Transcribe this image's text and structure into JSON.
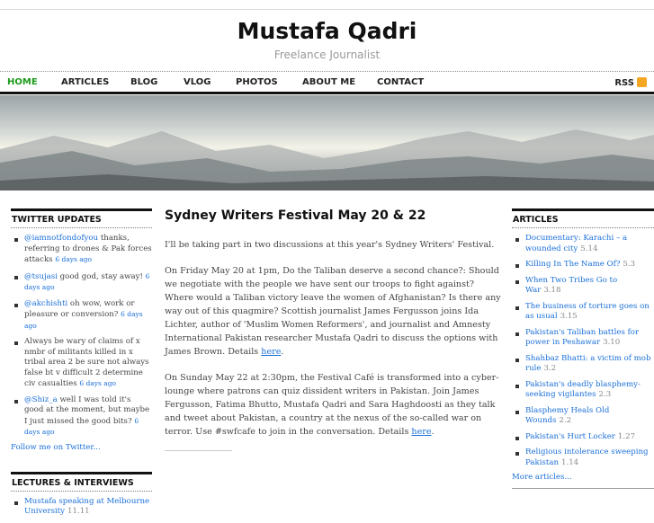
{
  "site": {
    "title": "Mustafa Qadri",
    "tagline": "Freelance Journalist"
  },
  "nav": {
    "items": [
      "HOME",
      "ARTICLES",
      "BLOG",
      "VLOG",
      "PHOTOS",
      "ABOUT ME",
      "CONTACT"
    ],
    "rss": "RSS"
  },
  "twitter": {
    "heading": "TWITTER UPDATES",
    "tweets": [
      {
        "user": "@iamnotfondofyou",
        "text": " thanks, referring to drones & Pak forces attacks ",
        "ago": "6 days ago"
      },
      {
        "user": "@tsujasi",
        "text": " good god, stay away! ",
        "ago": "6 days ago"
      },
      {
        "user": "@akchishti",
        "text": " oh wow, work or pleasure or conversion? ",
        "ago": "6 days ago"
      },
      {
        "user": "",
        "text": "Always be wary of claims of x nmbr of militants killed in x tribal area 2 be sure not always false bt v difficult 2 determine civ casualties ",
        "ago": "6 days ago"
      },
      {
        "user": "@Shiz_a",
        "text": " well I was told it's good at the moment, but maybe I just missed the good bits? ",
        "ago": "6 days ago"
      }
    ],
    "follow": "Follow me on Twitter..."
  },
  "lectures": {
    "heading": "LECTURES & INTERVIEWS",
    "items": [
      {
        "title": "Mustafa speaking at Melbourne University",
        "date": "11.11"
      }
    ]
  },
  "post": {
    "title": "Sydney Writers Festival May 20 & 22",
    "p1": "I'll be taking part in two discussions at this year's Sydney Writers' Festival.",
    "p2": "On Friday May 20 at 1pm, Do the Taliban deserve a second chance?: Should we negotiate with the people we have sent our troops to fight against? Where would a Taliban victory leave the women of Afghanistan? Is there any way out of this quagmire? Scottish journalist James Fergusson joins Ida Lichter, author of 'Muslim Women Reformers', and journalist and Amnesty International Pakistan researcher Mustafa Qadri to discuss the options with James Brown. Details ",
    "p3": "On Sunday May 22 at 2:30pm, the Festival Café is transformed into a cyber-lounge where patrons can quiz dissident writers in Pakistan. Join James Fergusson, Fatima Bhutto, Mustafa Qadri and Sara Haghdoosti as they talk and tweet about Pakistan, a country at the nexus of the so-called war on terror. Use #swfcafe to join in the conversation. Details ",
    "link": "here",
    "end": "."
  },
  "articles": {
    "heading": "ARTICLES",
    "items": [
      {
        "title": "Documentary: Karachi – a wounded city",
        "date": "5.14"
      },
      {
        "title": "Killing In The Name Of?",
        "date": "5.3"
      },
      {
        "title": "When Two Tribes Go to War",
        "date": "3.18"
      },
      {
        "title": "The business of torture goes on as usual",
        "date": "3.15"
      },
      {
        "title": "Pakistan's Taliban battles for power in Peshawar",
        "date": "3.10"
      },
      {
        "title": "Shahbaz Bhatti: a victim of mob rule",
        "date": "3.2"
      },
      {
        "title": "Pakistan's deadly blasphemy-seeking vigilantes",
        "date": "2.3"
      },
      {
        "title": "Blasphemy Heals Old Wounds",
        "date": "2.2"
      },
      {
        "title": "Pakistan's Hurt Locker",
        "date": "1.27"
      },
      {
        "title": "Religious intolerance sweeping Pakistan",
        "date": "1.14"
      }
    ],
    "more": "More articles..."
  }
}
